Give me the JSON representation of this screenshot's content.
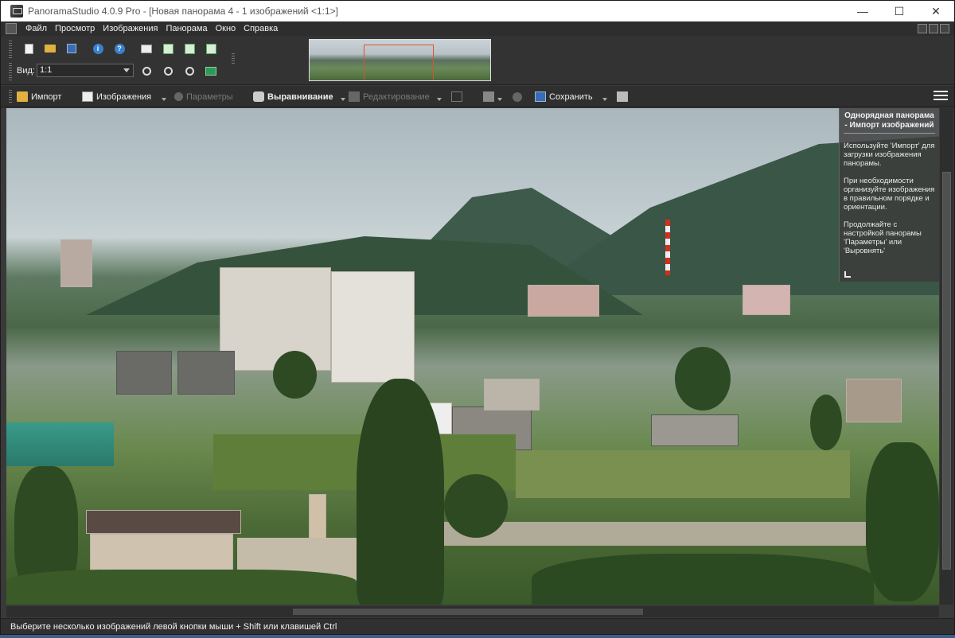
{
  "window": {
    "title": "PanoramaStudio 4.0.9 Pro - [Новая панорама 4 - 1 изображений <1:1>]",
    "minimize_label": "—",
    "maximize_label": "☐",
    "close_label": "✕"
  },
  "menu": {
    "items": [
      "Файл",
      "Просмотр",
      "Изображения",
      "Панорама",
      "Окно",
      "Справка"
    ]
  },
  "toolbar": {
    "view_label": "Вид:",
    "view_value": "1:1"
  },
  "mainbar": {
    "import_label": "Импорт",
    "images_label": "Изображения",
    "params_label": "Параметры",
    "align_label": "Выравнивание",
    "edit_label": "Редактирование",
    "save_label": "Сохранить"
  },
  "help": {
    "title": "Однорядная панорама - Импорт изображений",
    "paragraphs": [
      "Используйте 'Импорт' для загрузки изображения панорамы.",
      "При необходимости организуйте изображения в правильном порядке и ориентации.",
      "Продолжайте с настройкой панорамы 'Параметры' или 'Выровнять'"
    ]
  },
  "status": {
    "text": "Выберите несколько изображений левой кнопки мыши + Shift или клавишей Ctrl"
  },
  "colors": {
    "app_bg": "#3a3a3a",
    "toolbar_bg": "#2f2f2f",
    "text": "#f0f0f0",
    "disabled_text": "#7a7a7a",
    "navigator_frame": "#e05030"
  }
}
